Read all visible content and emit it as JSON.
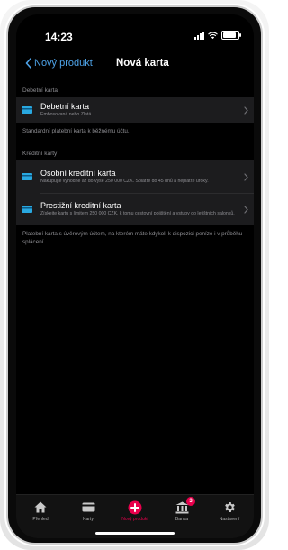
{
  "status_bar": {
    "time": "14:23"
  },
  "nav": {
    "back_label": "Nový produkt",
    "title": "Nová karta"
  },
  "sections": {
    "debit": {
      "header": "Debetní karta",
      "items": [
        {
          "title": "Debetní karta",
          "subtitle": "Embosovaná nebo Zlatá"
        }
      ],
      "footer": "Standardní platební karta k běžnému účtu."
    },
    "credit": {
      "header": "Kreditní karty",
      "items": [
        {
          "title": "Osobní kreditní karta",
          "subtitle": "Nakupujte výhodně až do výše 250 000 CZK. Splaťte do 45 dnů a neplaťte úroky."
        },
        {
          "title": "Prestižní kreditní karta",
          "subtitle": "Získejte kartu s limitem 250 000 CZK, k tomu cestovní pojištění a vstupy do letištních salonků."
        }
      ],
      "footer": "Platební karta s úvěrovým účtem, na kterém máte kdykoli k dispozici peníze i v průběhu splácení."
    }
  },
  "tab_bar": {
    "tabs": [
      {
        "label": "Přehled",
        "icon": "home-icon"
      },
      {
        "label": "Karty",
        "icon": "card-icon"
      },
      {
        "label": "Nový produkt",
        "icon": "plus-circle-icon",
        "active": true
      },
      {
        "label": "Banka",
        "icon": "bank-icon",
        "badge": "3"
      },
      {
        "label": "Nastavení",
        "icon": "gear-icon"
      }
    ]
  },
  "colors": {
    "accent": "#4ea3e8",
    "active_tab": "#e8004c",
    "cell_bg": "#1c1c1e",
    "card_icon": "#29a8e0"
  }
}
